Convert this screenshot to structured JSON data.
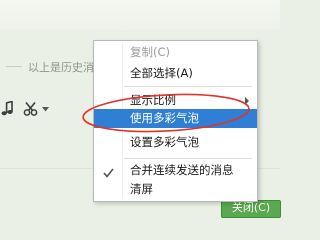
{
  "chat": {
    "history_label": "以上是历史消"
  },
  "toolbar": {
    "icons": [
      "music-note-icon",
      "scissors-icon",
      "dropdown-arrow-icon"
    ]
  },
  "bottom": {
    "send_label": "关闭(C)"
  },
  "context_menu": {
    "items": [
      {
        "label": "复制(C)",
        "enabled": false
      },
      {
        "label": "全部选择(A)",
        "enabled": true
      },
      {
        "label": "显示比例",
        "enabled": true,
        "has_submenu": true
      },
      {
        "label": "使用多彩气泡",
        "enabled": true,
        "highlighted": true
      },
      {
        "label": "设置多彩气泡",
        "enabled": true
      },
      {
        "label": "合并连续发送的消息",
        "enabled": true,
        "checked": true
      },
      {
        "label": "清屏",
        "enabled": true
      }
    ]
  },
  "colors": {
    "highlight": "#2f7fd4",
    "annotation": "#e0342b",
    "send_button": "#5aa84f"
  }
}
